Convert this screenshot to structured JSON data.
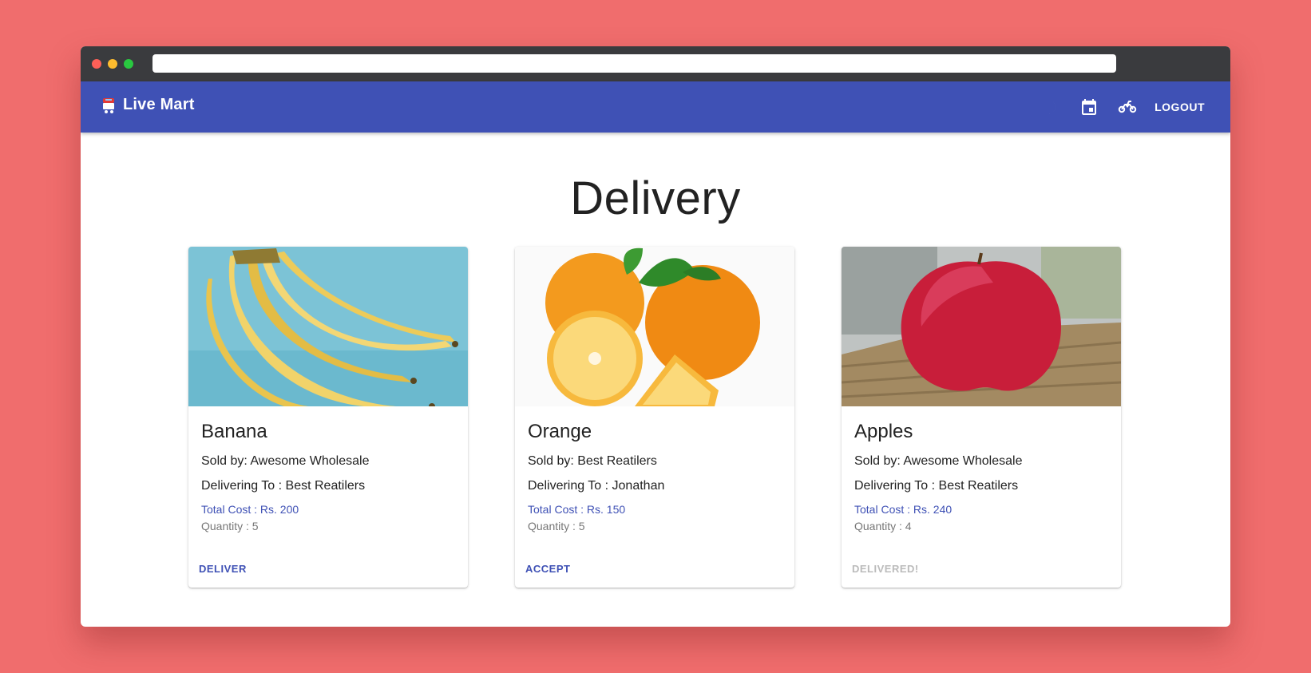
{
  "app": {
    "title": "Live Mart",
    "logout_label": "LOGOUT",
    "accent": "#3f51b5",
    "icons": [
      "moon-icon",
      "calendar-icon",
      "motorbike-icon"
    ]
  },
  "page": {
    "heading": "Delivery"
  },
  "cards": [
    {
      "name": "Banana",
      "sold_by": "Sold by: Awesome Wholesale",
      "delivering_to": "Delivering To : Best Reatilers",
      "total_cost": "Total Cost : Rs. 200",
      "quantity": "Quantity : 5",
      "action": "DELIVER",
      "action_enabled": true
    },
    {
      "name": "Orange",
      "sold_by": "Sold by: Best Reatilers",
      "delivering_to": "Delivering To : Jonathan",
      "total_cost": "Total Cost : Rs. 150",
      "quantity": "Quantity : 5",
      "action": "ACCEPT",
      "action_enabled": true
    },
    {
      "name": "Apples",
      "sold_by": "Sold by: Awesome Wholesale",
      "delivering_to": "Delivering To : Best Reatilers",
      "total_cost": "Total Cost : Rs. 240",
      "quantity": "Quantity : 4",
      "action": "DELIVERED!",
      "action_enabled": false
    }
  ]
}
